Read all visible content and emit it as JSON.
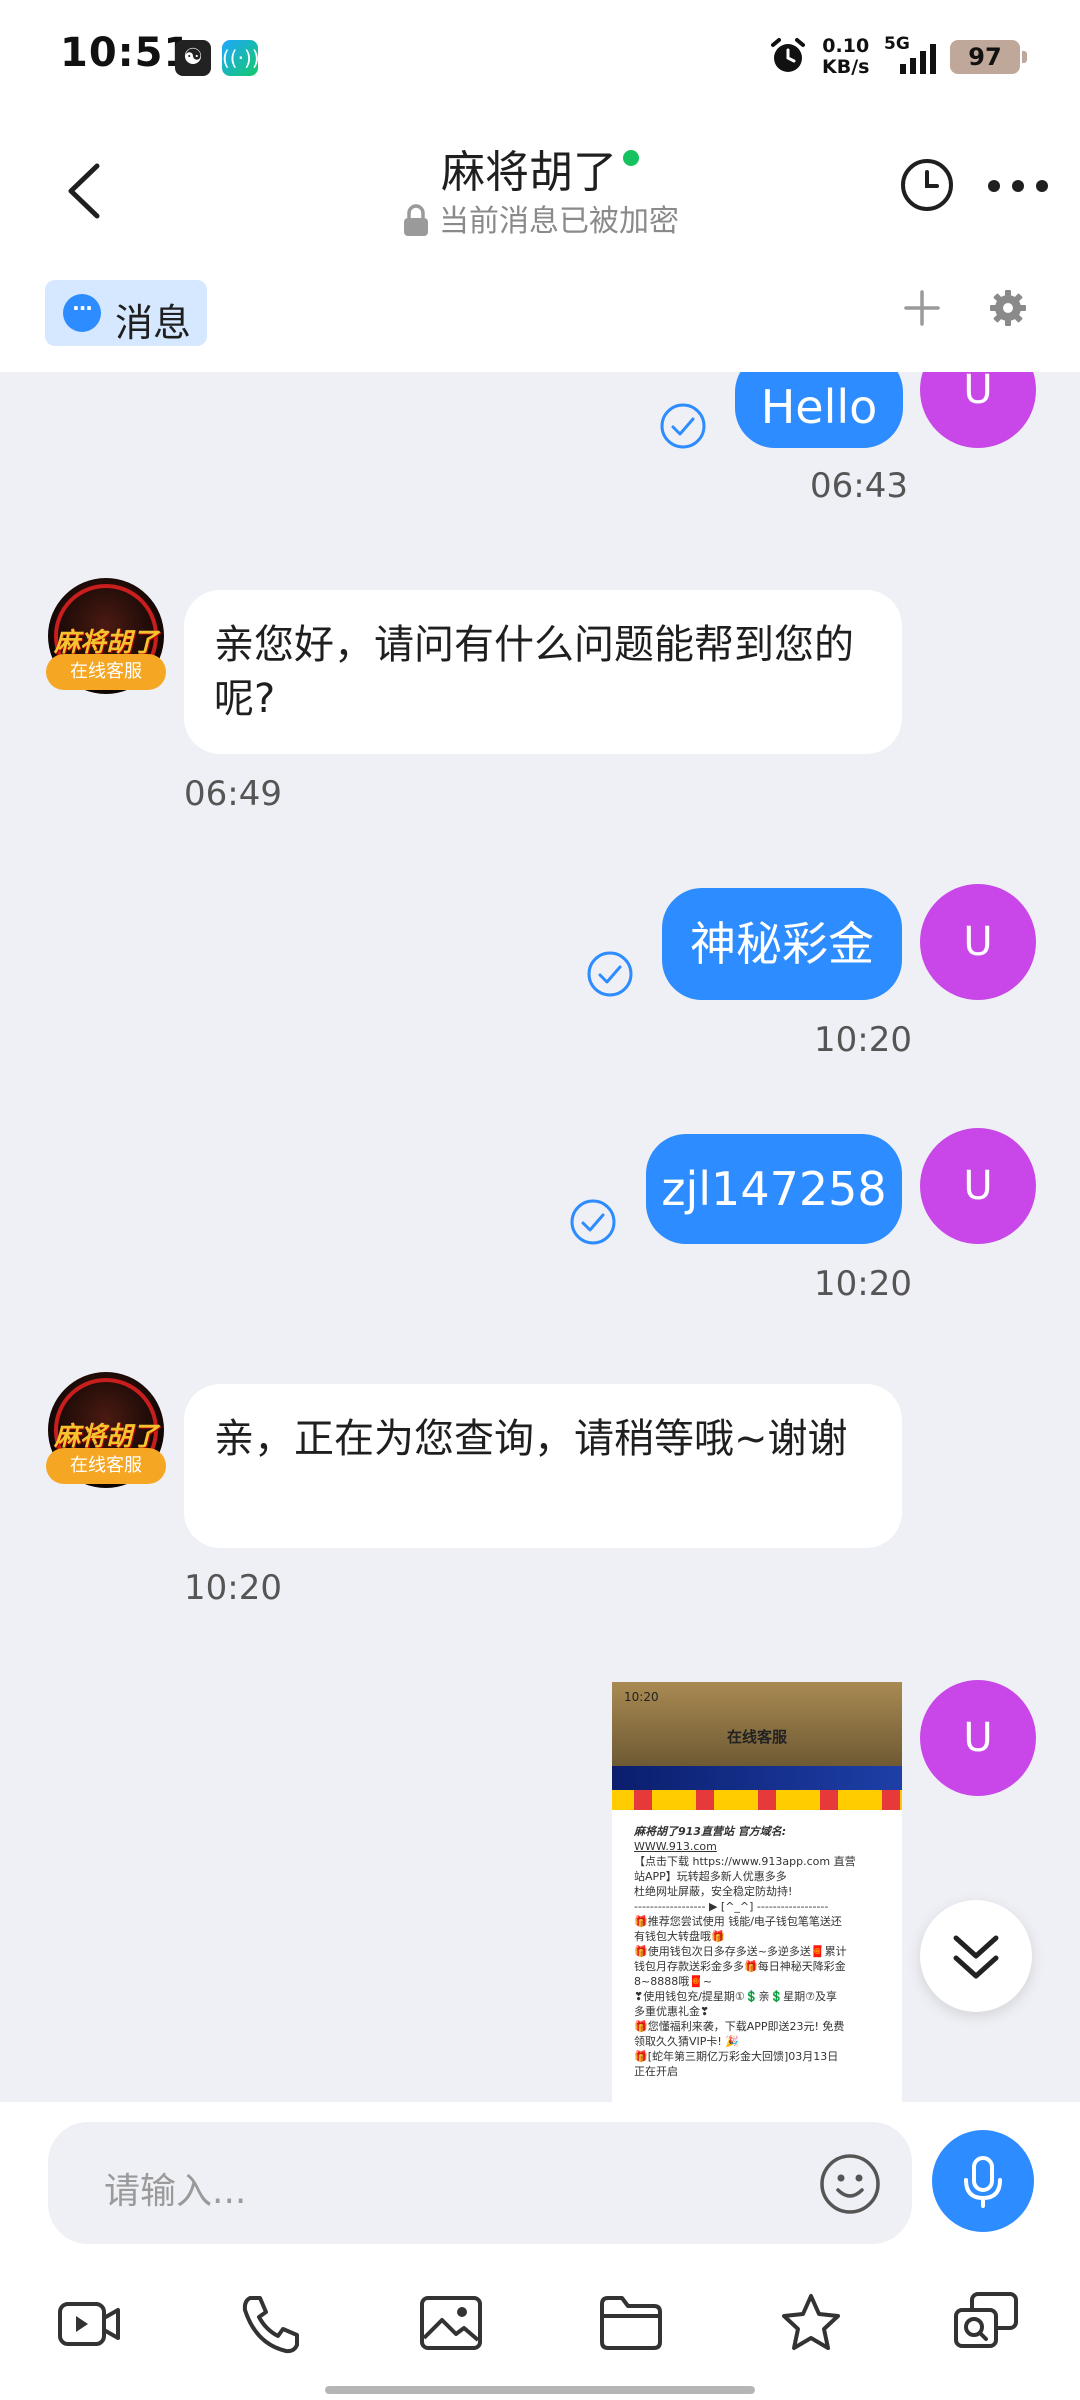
{
  "status_bar": {
    "time": "10:51",
    "speed_value": "0.10",
    "speed_unit": "KB/s",
    "network": "5G",
    "battery": "97"
  },
  "header": {
    "title": "麻将胡了",
    "subtitle": "当前消息已被加密"
  },
  "tabs": {
    "active_label": "消息"
  },
  "messages": [
    {
      "side": "out",
      "text": "Hello",
      "time": "06:43",
      "avatar": "U"
    },
    {
      "side": "in",
      "text": "亲您好，请问有什么问题能帮到您的呢?",
      "time": "06:49",
      "badge": "在线客服",
      "avatar_text": "麻将胡了"
    },
    {
      "side": "out",
      "text": "神秘彩金",
      "time": "10:20",
      "avatar": "U"
    },
    {
      "side": "out",
      "text": "zjl147258",
      "time": "10:20",
      "avatar": "U"
    },
    {
      "side": "in",
      "text": "亲，正在为您查询，请稍等哦~谢谢",
      "time": "10:20",
      "badge": "在线客服",
      "avatar_text": "麻将胡了"
    },
    {
      "side": "out",
      "type": "image",
      "avatar": "U"
    }
  ],
  "screenshot_preview": {
    "time": "10:20",
    "title": "在线客服",
    "lines": [
      "麻将胡了913直营站 官方域名:",
      "WWW.913.com",
      "【点击下载 https://www.913app.com 直营",
      "站APP】玩转超多新人优惠多多",
      "杜绝网址屏蔽，安全稳定防劫持!",
      "------------------ ▶ [^_^] ------------------",
      "🎁推荐您尝试使用 钱能/电子钱包笔笔送还",
      "有钱包大转盘哦🎁",
      "🎁使用钱包次日多存多送~多逆多送🧧累计",
      "钱包月存款送彩金多多🎁每日神秘天降彩金",
      "8~8888哦🧧~",
      "❣使用钱包充/提星期①💲亲💲星期⑦及享",
      "多重优惠礼金❣",
      "🎁您懂福利来袭，下载APP即送23元! 免费",
      "领取久久猜VIP卡! 🎉",
      "🎁[蛇年第三期亿万彩金大回馈]03月13日",
      "正在开启"
    ]
  },
  "input": {
    "placeholder": "请输入..."
  },
  "colors": {
    "accent": "#2d8cff",
    "user_avatar": "#c946e8",
    "online": "#16c25f",
    "badge": "#f5a623",
    "chat_bg": "#eff0f5"
  },
  "icons": [
    "back-icon",
    "history-icon",
    "more-icon",
    "chat-bubble-icon",
    "plus-icon",
    "gear-icon",
    "check-circle-icon",
    "chevron-double-down-icon",
    "emoji-icon",
    "microphone-icon",
    "video-icon",
    "phone-icon",
    "image-icon",
    "folder-icon",
    "star-icon",
    "search-chat-icon"
  ]
}
